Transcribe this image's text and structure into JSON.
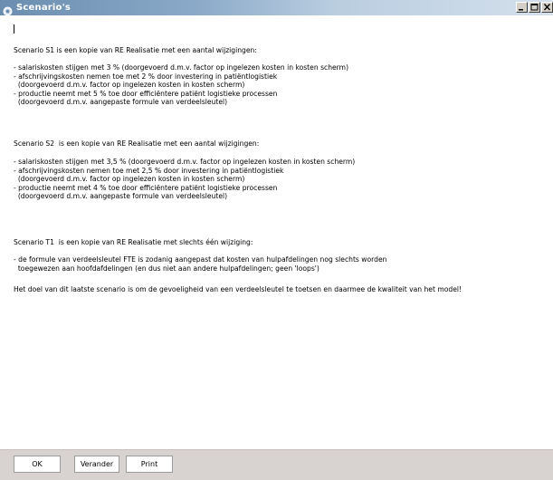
{
  "window": {
    "title": "Scenario's",
    "controls": [
      "minimize-icon",
      "maximize-icon",
      "close-icon"
    ]
  },
  "content": {
    "paragraphs": [
      "Scenario S1 is een kopie van RE Realisatie met een aantal wijzigingen:",
      "- salariskosten stijgen met 3 % (doorgevoerd d.m.v. factor op ingelezen kosten in kosten scherm)\n- afschrijvingskosten nemen toe met 2 % door investering in patiëntlogistiek\n  (doorgevoerd d.m.v. factor op ingelezen kosten in kosten scherm)\n- productie neemt met 5 % toe door efficiëntere patiënt logistieke processen\n  (doorgevoerd d.m.v. aangepaste formule van verdeelsleutel)",
      "Scenario S2  is een kopie van RE Realisatie met een aantal wijzigingen:",
      "- salariskosten stijgen met 3,5 % (doorgevoerd d.m.v. factor op ingelezen kosten in kosten scherm)\n- afschrijvingskosten nemen toe met 2,5 % door investering in patiëntlogistiek\n  (doorgevoerd d.m.v. factor op ingelezen kosten in kosten scherm)\n- productie neemt met 4 % toe door efficiëntere patiënt logistieke processen\n  (doorgevoerd d.m.v. aangepaste formule van verdeelsleutel)",
      "Scenario T1  is een kopie van RE Realisatie met slechts één wijziging:",
      "- de formule van verdeelsleutel FTE is zodanig aangepast dat kosten van hulpafdelingen nog slechts worden\n  toegewezen aan hoofdafdelingen (en dus niet aan andere hulpafdelingen; geen 'loops')",
      "Het doel van dit laatste scenario is om de gevoeligheid van een verdeelsleutel te toetsen en daarmee de kwaliteit van het model!"
    ]
  },
  "buttons": {
    "ok": "OK",
    "verander": "Verander",
    "print": "Print"
  },
  "colors": {
    "titlebar_start": "#6b8eb0",
    "titlebar_end": "#d4e0ec",
    "frame": "#d8d2d0"
  }
}
